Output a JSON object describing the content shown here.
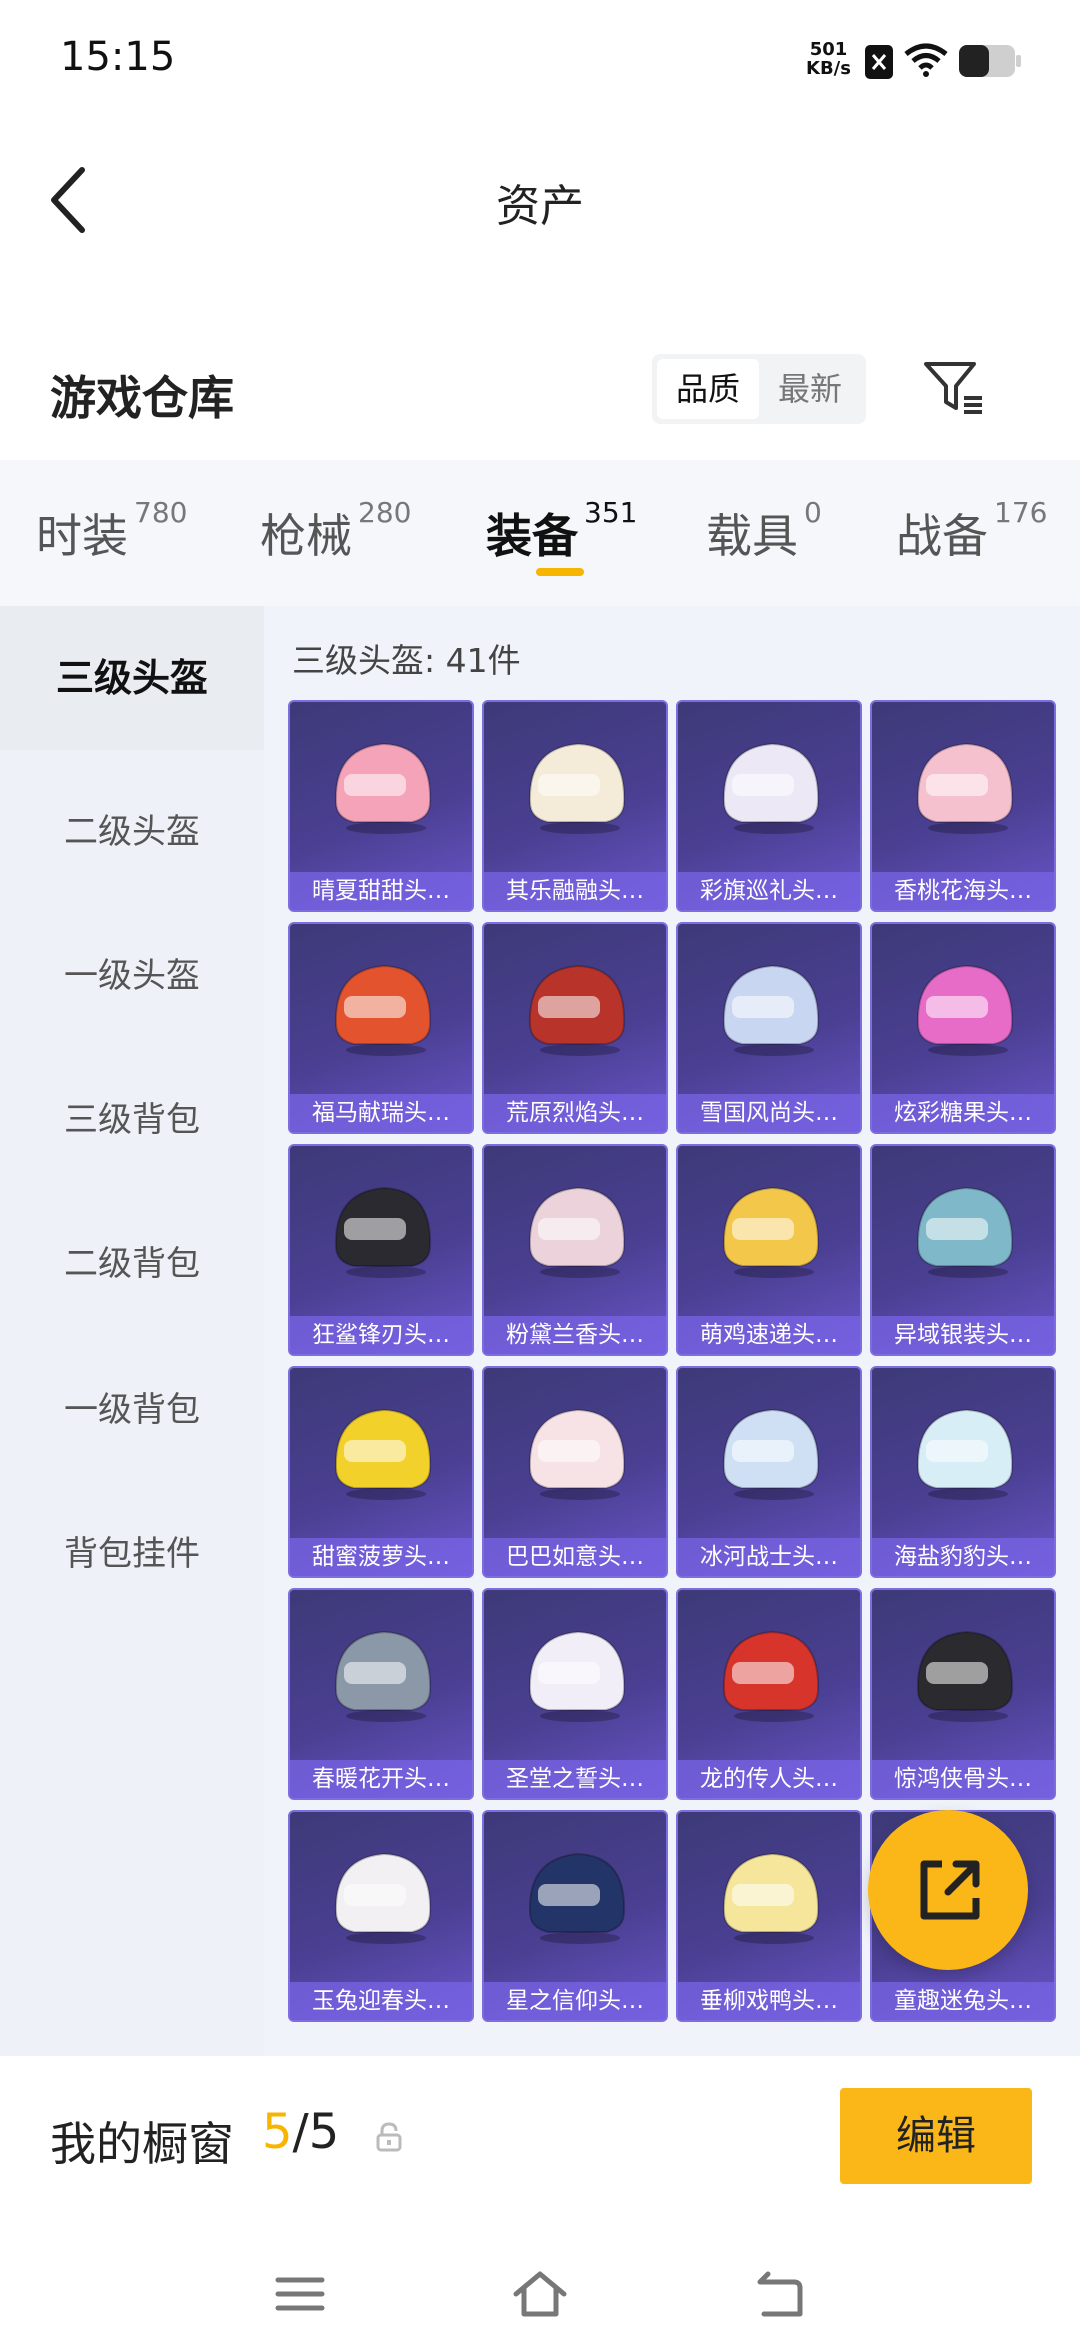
{
  "status_bar": {
    "time": "15:15",
    "net_speed_value": "501",
    "net_speed_unit": "KB/s"
  },
  "header": {
    "title": "资产"
  },
  "warehouse": {
    "title": "游戏仓库",
    "sort_options": [
      "品质",
      "最新"
    ],
    "sort_selected": "品质"
  },
  "tabs": [
    {
      "label": "时装",
      "count": "780"
    },
    {
      "label": "枪械",
      "count": "280"
    },
    {
      "label": "装备",
      "count": "351"
    },
    {
      "label": "载具",
      "count": "0"
    },
    {
      "label": "战备",
      "count": "176"
    }
  ],
  "active_tab": "装备",
  "sidebar": {
    "items": [
      "三级头盔",
      "二级头盔",
      "一级头盔",
      "三级背包",
      "二级背包",
      "一级背包",
      "背包挂件"
    ],
    "selected": "三级头盔"
  },
  "content": {
    "count_label": "三级头盔: 41件",
    "items": [
      {
        "name": "晴夏甜甜头…",
        "color": "#f4a3b8"
      },
      {
        "name": "其乐融融头…",
        "color": "#f4ecd8"
      },
      {
        "name": "彩旗巡礼头…",
        "color": "#ece8f6"
      },
      {
        "name": "香桃花海头…",
        "color": "#f6c1cf"
      },
      {
        "name": "福马献瑞头…",
        "color": "#e3542e"
      },
      {
        "name": "荒原烈焰头…",
        "color": "#b8342a"
      },
      {
        "name": "雪国风尚头…",
        "color": "#c9d6f2"
      },
      {
        "name": "炫彩糖果头…",
        "color": "#e66cc8"
      },
      {
        "name": "狂鲨锋刃头…",
        "color": "#2a2a30"
      },
      {
        "name": "粉黛兰香头…",
        "color": "#ecd2da"
      },
      {
        "name": "萌鸡速递头…",
        "color": "#f3c74a"
      },
      {
        "name": "异域银装头…",
        "color": "#7fb8c8"
      },
      {
        "name": "甜蜜菠萝头…",
        "color": "#f2d12a"
      },
      {
        "name": "巴巴如意头…",
        "color": "#f7e3e6"
      },
      {
        "name": "冰河战士头…",
        "color": "#cfe0f5"
      },
      {
        "name": "海盐豹豹头…",
        "color": "#d8eef7"
      },
      {
        "name": "春暖花开头…",
        "color": "#8a98a8"
      },
      {
        "name": "圣堂之誓头…",
        "color": "#f1eef8"
      },
      {
        "name": "龙的传人头…",
        "color": "#d7342b"
      },
      {
        "name": "惊鸿侠骨头…",
        "color": "#2b2a2e"
      },
      {
        "name": "玉兔迎春头…",
        "color": "#f2f0f2"
      },
      {
        "name": "星之信仰头…",
        "color": "#233468"
      },
      {
        "name": "垂柳戏鸭头…",
        "color": "#f6e69c"
      },
      {
        "name": "童趣迷兔头…",
        "color": "#f0efee"
      }
    ]
  },
  "showcase": {
    "title": "我的橱窗",
    "current": "5",
    "total": "/5",
    "edit_label": "编辑"
  },
  "colors": {
    "accent": "#fbb718",
    "card_top": "#3d3a78",
    "card_bottom": "#6a55c8"
  }
}
